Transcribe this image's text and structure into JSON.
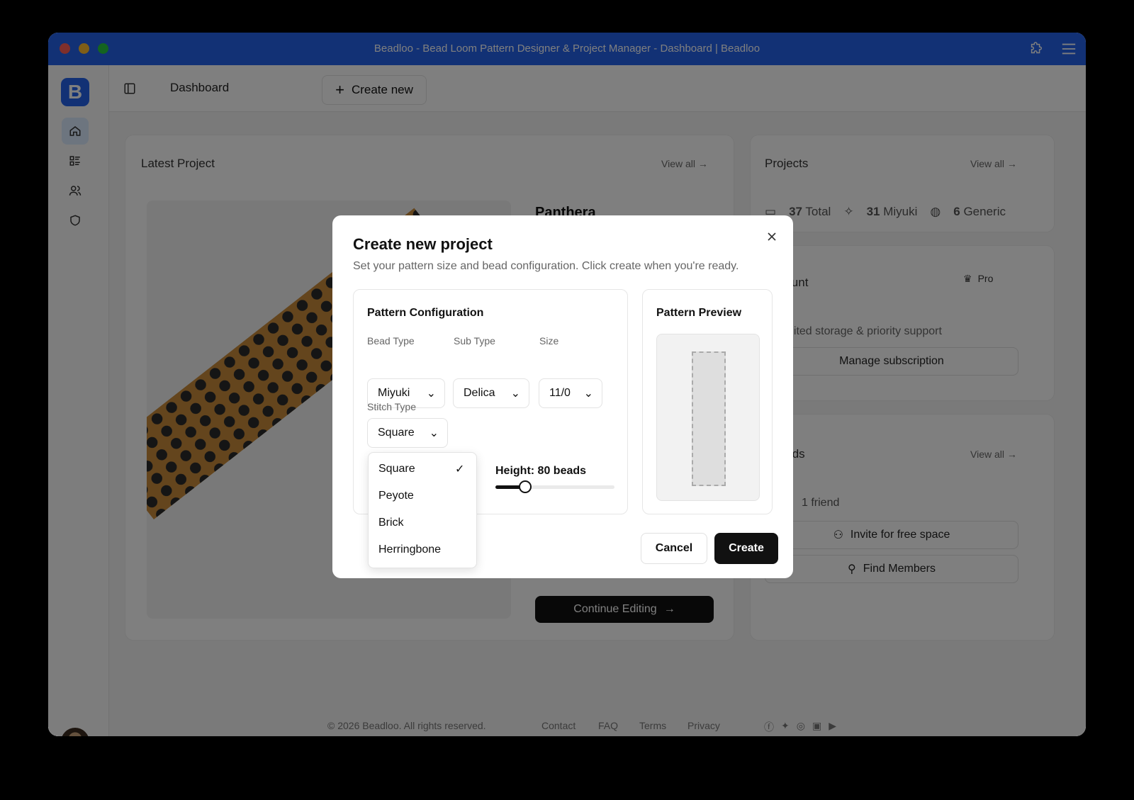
{
  "window": {
    "title": "Beadloo - Bead Loom Pattern Designer & Project Manager - Dashboard | Beadloo"
  },
  "sidebar": {
    "logo_letter": "B"
  },
  "topbar": {
    "breadcrumb": "Dashboard",
    "create_new_label": "Create new"
  },
  "latest_project": {
    "title": "Latest Project",
    "view_all": "View all →",
    "project_name": "Panthera",
    "continue_label": "Continue Editing"
  },
  "projects": {
    "title": "Projects",
    "view_all": "View all →",
    "total_count": "37",
    "total_label": "Total",
    "miyuki_count": "31",
    "miyuki_label": "Miyuki",
    "generic_count": "6",
    "generic_label": "Generic"
  },
  "account": {
    "title": "Account",
    "badge": "Pro",
    "description": "Unlimited storage & priority support",
    "manage_label": "Manage subscription"
  },
  "friends": {
    "title": "Friends",
    "view_all": "View all →",
    "count_label": "1 friend",
    "invite_label": "Invite for free space",
    "find_label": "Find Members"
  },
  "footer": {
    "copyright": "© 2026 Beadloo. All rights reserved.",
    "links": [
      "Contact",
      "FAQ",
      "Terms",
      "Privacy"
    ]
  },
  "modal": {
    "title": "Create new project",
    "description": "Set your pattern size and bead configuration. Click create when you're ready.",
    "config_title": "Pattern Configuration",
    "bead_type_label": "Bead Type",
    "bead_type_value": "Miyuki",
    "sub_type_label": "Sub Type",
    "sub_type_value": "Delica",
    "size_label": "Size",
    "size_value": "11/0",
    "stitch_type_label": "Stitch Type",
    "stitch_type_value": "Square",
    "stitch_options": [
      "Square",
      "Peyote",
      "Brick",
      "Herringbone"
    ],
    "height_label": "Height: 80 beads",
    "height_slider_fraction": 0.25,
    "preview_title": "Pattern Preview",
    "cancel_label": "Cancel",
    "create_label": "Create"
  },
  "colors": {
    "brand": "#2563eb",
    "primary_button": "#111111"
  }
}
